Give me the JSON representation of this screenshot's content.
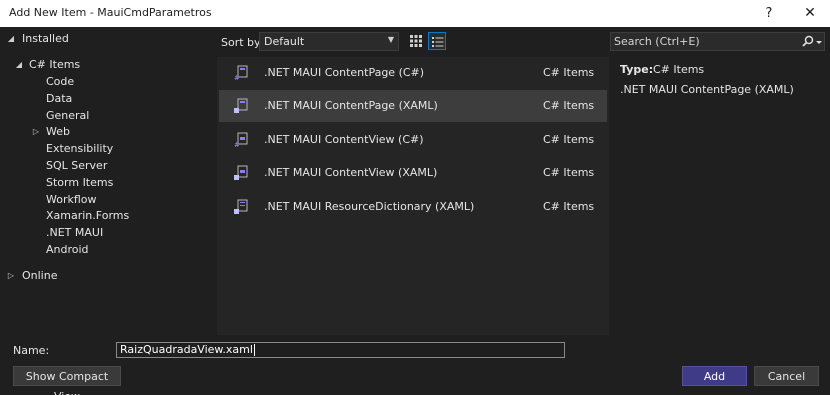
{
  "window": {
    "title": "Add New Item - MauiCmdParametros",
    "help_glyph": "?",
    "close_glyph": "✕"
  },
  "tree": {
    "installed": "Installed",
    "csharp_items": "C# Items",
    "children": [
      "Code",
      "Data",
      "General",
      "Web",
      "Extensibility",
      "SQL Server",
      "Storm Items",
      "Workflow",
      "Xamarin.Forms",
      ".NET MAUI",
      "Android"
    ],
    "online": "Online"
  },
  "toolbar": {
    "sort_by_label": "Sort by:",
    "sort_value": "Default"
  },
  "templates": [
    {
      "name": ".NET MAUI ContentPage (C#)",
      "category": "C# Items",
      "icon": "csharp-page-icon",
      "selected": false
    },
    {
      "name": ".NET MAUI ContentPage (XAML)",
      "category": "C# Items",
      "icon": "xaml-page-icon",
      "selected": true
    },
    {
      "name": ".NET MAUI ContentView (C#)",
      "category": "C# Items",
      "icon": "csharp-view-icon",
      "selected": false
    },
    {
      "name": ".NET MAUI ContentView (XAML)",
      "category": "C# Items",
      "icon": "xaml-view-icon",
      "selected": false
    },
    {
      "name": ".NET MAUI ResourceDictionary (XAML)",
      "category": "C# Items",
      "icon": "xaml-dictionary-icon",
      "selected": false
    }
  ],
  "search": {
    "placeholder": "Search (Ctrl+E)"
  },
  "details": {
    "type_label": "Type:",
    "type_value": "C# Items",
    "description": ".NET MAUI ContentPage (XAML)"
  },
  "form": {
    "name_label": "Name:",
    "name_value": "RaizQuadradaView.xaml"
  },
  "buttons": {
    "compact_view": "Show Compact View",
    "add": "Add",
    "cancel": "Cancel"
  },
  "colors": {
    "accent_add_button": "#3f3b86",
    "selected_row": "#3d3d3d",
    "background": "#1f1f1f",
    "list_background": "#252526"
  }
}
